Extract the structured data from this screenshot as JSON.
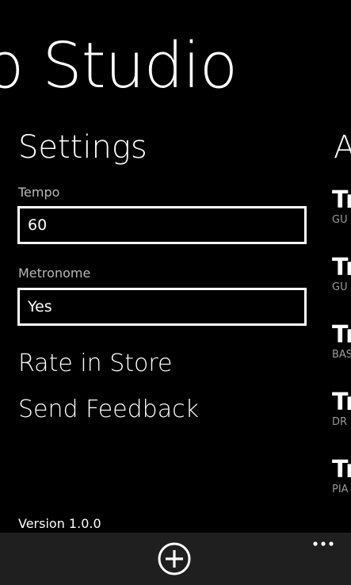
{
  "app": {
    "title": "o Studio"
  },
  "settings": {
    "header": "Settings",
    "tempo": {
      "label": "Tempo",
      "value": "60"
    },
    "metronome": {
      "label": "Metronome",
      "value": "Yes"
    },
    "rate_in_store": "Rate in Store",
    "send_feedback": "Send Feedback",
    "version": "Version 1.0.0"
  },
  "tracks_panel": {
    "header_fragment": "A",
    "tracks": [
      {
        "name": "Tr",
        "instrument": "GU"
      },
      {
        "name": "Tr",
        "instrument": "GU"
      },
      {
        "name": "Tr",
        "instrument": "BAS"
      },
      {
        "name": "Tr",
        "instrument": "DR"
      },
      {
        "name": "Tr",
        "instrument": "PIA"
      }
    ]
  },
  "app_bar": {
    "icons": {
      "add": "add-circle-icon",
      "more": "more-ellipsis-icon"
    },
    "background_color": "#1f1f1f"
  }
}
